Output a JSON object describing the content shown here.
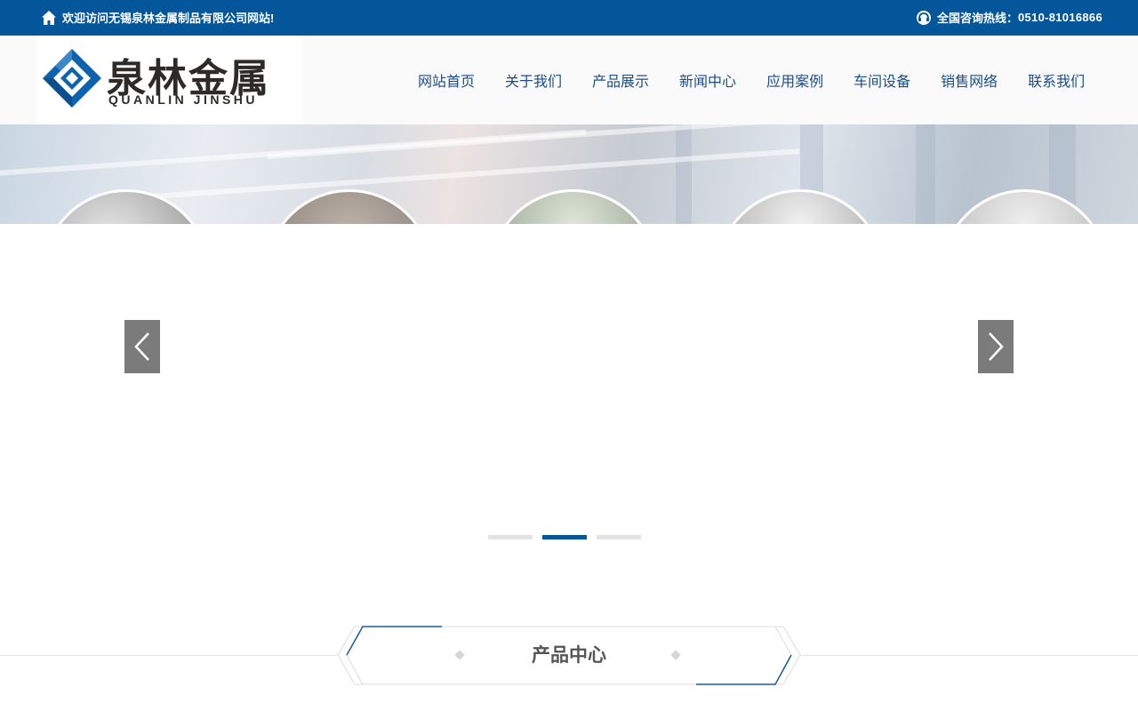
{
  "topbar": {
    "welcome_text": "欢迎访问无锡泉林金属制品有限公司网站!",
    "hotline_label": "全国咨询热线：",
    "hotline_number": "0510-81016866",
    "home_icon": "home-icon",
    "phone_icon": "headset-icon"
  },
  "logo": {
    "cn": "泉林金属",
    "en": "QUANLIN JINSHU"
  },
  "nav": {
    "items": [
      {
        "label": "网站首页"
      },
      {
        "label": "关于我们"
      },
      {
        "label": "产品展示"
      },
      {
        "label": "新闻中心"
      },
      {
        "label": "应用案例"
      },
      {
        "label": "车间设备"
      },
      {
        "label": "销售网络"
      },
      {
        "label": "联系我们"
      }
    ]
  },
  "slider": {
    "active_index": 1,
    "dot_count": 3
  },
  "section": {
    "title": "产品中心"
  },
  "colors": {
    "brand_blue": "#03569a",
    "nav_text": "#1a4d86",
    "arrow_bg": "#7b7b7b",
    "dot_inactive": "#e3e3e3"
  }
}
